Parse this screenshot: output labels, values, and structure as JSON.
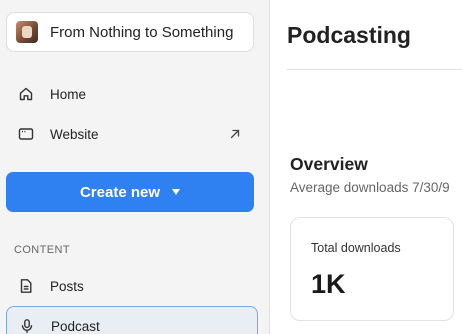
{
  "sidebar": {
    "publication": {
      "name": "From Nothing to Something"
    },
    "nav": {
      "home": "Home",
      "website": "Website",
      "posts": "Posts",
      "podcast": "Podcast"
    },
    "create_button": "Create new",
    "section_content": "CONTENT"
  },
  "main": {
    "title": "Podcasting",
    "overview": {
      "title": "Overview",
      "subtitle": "Average downloads 7/30/9"
    },
    "stat": {
      "label": "Total downloads",
      "value": "1K"
    }
  },
  "colors": {
    "accent": "#2f80f0",
    "sidebar_bg": "#f4f4f4",
    "active_bg": "#e9eef5",
    "active_border": "#79a6e8"
  },
  "icons": {
    "home": "home-icon",
    "website": "browser-window-icon",
    "external": "arrow-up-right-icon",
    "posts": "document-icon",
    "podcast": "microphone-icon",
    "dropdown": "caret-down-icon"
  }
}
